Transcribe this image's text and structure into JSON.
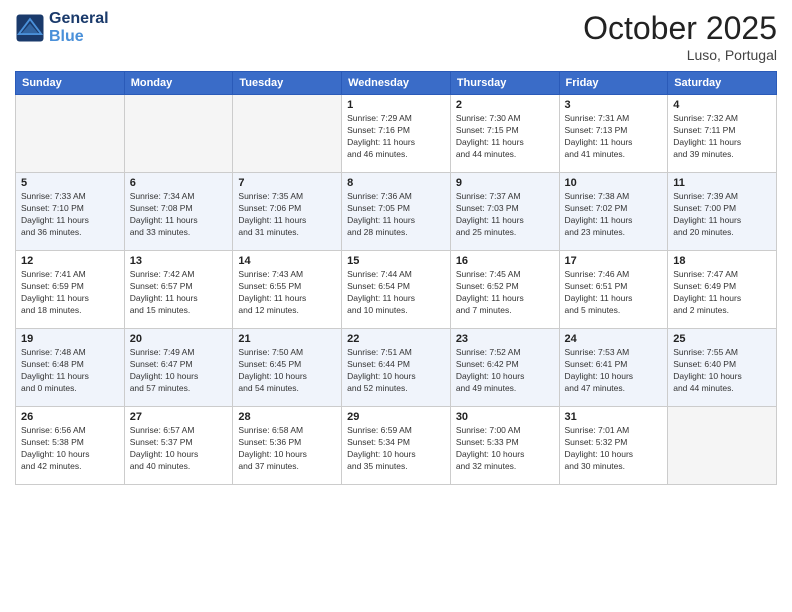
{
  "header": {
    "logo_line1": "General",
    "logo_line2": "Blue",
    "month": "October 2025",
    "location": "Luso, Portugal"
  },
  "weekdays": [
    "Sunday",
    "Monday",
    "Tuesday",
    "Wednesday",
    "Thursday",
    "Friday",
    "Saturday"
  ],
  "weeks": [
    [
      {
        "day": "",
        "detail": ""
      },
      {
        "day": "",
        "detail": ""
      },
      {
        "day": "",
        "detail": ""
      },
      {
        "day": "1",
        "detail": "Sunrise: 7:29 AM\nSunset: 7:16 PM\nDaylight: 11 hours\nand 46 minutes."
      },
      {
        "day": "2",
        "detail": "Sunrise: 7:30 AM\nSunset: 7:15 PM\nDaylight: 11 hours\nand 44 minutes."
      },
      {
        "day": "3",
        "detail": "Sunrise: 7:31 AM\nSunset: 7:13 PM\nDaylight: 11 hours\nand 41 minutes."
      },
      {
        "day": "4",
        "detail": "Sunrise: 7:32 AM\nSunset: 7:11 PM\nDaylight: 11 hours\nand 39 minutes."
      }
    ],
    [
      {
        "day": "5",
        "detail": "Sunrise: 7:33 AM\nSunset: 7:10 PM\nDaylight: 11 hours\nand 36 minutes."
      },
      {
        "day": "6",
        "detail": "Sunrise: 7:34 AM\nSunset: 7:08 PM\nDaylight: 11 hours\nand 33 minutes."
      },
      {
        "day": "7",
        "detail": "Sunrise: 7:35 AM\nSunset: 7:06 PM\nDaylight: 11 hours\nand 31 minutes."
      },
      {
        "day": "8",
        "detail": "Sunrise: 7:36 AM\nSunset: 7:05 PM\nDaylight: 11 hours\nand 28 minutes."
      },
      {
        "day": "9",
        "detail": "Sunrise: 7:37 AM\nSunset: 7:03 PM\nDaylight: 11 hours\nand 25 minutes."
      },
      {
        "day": "10",
        "detail": "Sunrise: 7:38 AM\nSunset: 7:02 PM\nDaylight: 11 hours\nand 23 minutes."
      },
      {
        "day": "11",
        "detail": "Sunrise: 7:39 AM\nSunset: 7:00 PM\nDaylight: 11 hours\nand 20 minutes."
      }
    ],
    [
      {
        "day": "12",
        "detail": "Sunrise: 7:41 AM\nSunset: 6:59 PM\nDaylight: 11 hours\nand 18 minutes."
      },
      {
        "day": "13",
        "detail": "Sunrise: 7:42 AM\nSunset: 6:57 PM\nDaylight: 11 hours\nand 15 minutes."
      },
      {
        "day": "14",
        "detail": "Sunrise: 7:43 AM\nSunset: 6:55 PM\nDaylight: 11 hours\nand 12 minutes."
      },
      {
        "day": "15",
        "detail": "Sunrise: 7:44 AM\nSunset: 6:54 PM\nDaylight: 11 hours\nand 10 minutes."
      },
      {
        "day": "16",
        "detail": "Sunrise: 7:45 AM\nSunset: 6:52 PM\nDaylight: 11 hours\nand 7 minutes."
      },
      {
        "day": "17",
        "detail": "Sunrise: 7:46 AM\nSunset: 6:51 PM\nDaylight: 11 hours\nand 5 minutes."
      },
      {
        "day": "18",
        "detail": "Sunrise: 7:47 AM\nSunset: 6:49 PM\nDaylight: 11 hours\nand 2 minutes."
      }
    ],
    [
      {
        "day": "19",
        "detail": "Sunrise: 7:48 AM\nSunset: 6:48 PM\nDaylight: 11 hours\nand 0 minutes."
      },
      {
        "day": "20",
        "detail": "Sunrise: 7:49 AM\nSunset: 6:47 PM\nDaylight: 10 hours\nand 57 minutes."
      },
      {
        "day": "21",
        "detail": "Sunrise: 7:50 AM\nSunset: 6:45 PM\nDaylight: 10 hours\nand 54 minutes."
      },
      {
        "day": "22",
        "detail": "Sunrise: 7:51 AM\nSunset: 6:44 PM\nDaylight: 10 hours\nand 52 minutes."
      },
      {
        "day": "23",
        "detail": "Sunrise: 7:52 AM\nSunset: 6:42 PM\nDaylight: 10 hours\nand 49 minutes."
      },
      {
        "day": "24",
        "detail": "Sunrise: 7:53 AM\nSunset: 6:41 PM\nDaylight: 10 hours\nand 47 minutes."
      },
      {
        "day": "25",
        "detail": "Sunrise: 7:55 AM\nSunset: 6:40 PM\nDaylight: 10 hours\nand 44 minutes."
      }
    ],
    [
      {
        "day": "26",
        "detail": "Sunrise: 6:56 AM\nSunset: 5:38 PM\nDaylight: 10 hours\nand 42 minutes."
      },
      {
        "day": "27",
        "detail": "Sunrise: 6:57 AM\nSunset: 5:37 PM\nDaylight: 10 hours\nand 40 minutes."
      },
      {
        "day": "28",
        "detail": "Sunrise: 6:58 AM\nSunset: 5:36 PM\nDaylight: 10 hours\nand 37 minutes."
      },
      {
        "day": "29",
        "detail": "Sunrise: 6:59 AM\nSunset: 5:34 PM\nDaylight: 10 hours\nand 35 minutes."
      },
      {
        "day": "30",
        "detail": "Sunrise: 7:00 AM\nSunset: 5:33 PM\nDaylight: 10 hours\nand 32 minutes."
      },
      {
        "day": "31",
        "detail": "Sunrise: 7:01 AM\nSunset: 5:32 PM\nDaylight: 10 hours\nand 30 minutes."
      },
      {
        "day": "",
        "detail": ""
      }
    ]
  ]
}
